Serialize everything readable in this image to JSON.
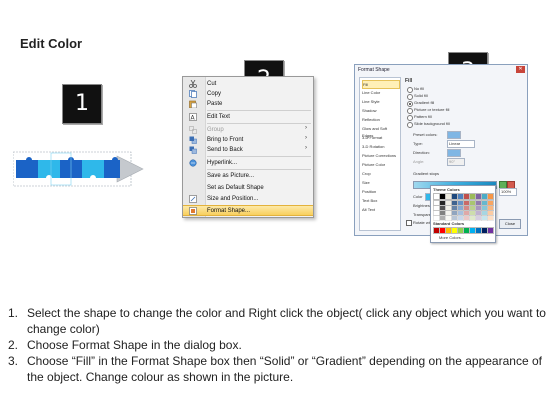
{
  "title": "Edit Color",
  "steps": [
    {
      "num": "1",
      "label": "1."
    },
    {
      "num": "2",
      "label": "2"
    },
    {
      "num": "3",
      "label": "3"
    }
  ],
  "context_menu": {
    "items": [
      {
        "label": "Cut",
        "icon": "scissors-icon",
        "disabled": false,
        "submenu": false
      },
      {
        "label": "Copy",
        "icon": "copy-icon",
        "disabled": false,
        "submenu": false
      },
      {
        "label": "Paste",
        "icon": "paste-icon",
        "disabled": false,
        "submenu": false
      },
      {
        "label": "Edit Text",
        "icon": "edit-text-icon",
        "disabled": false,
        "submenu": false
      },
      {
        "label": "Group",
        "icon": "group-icon",
        "disabled": true,
        "submenu": true
      },
      {
        "label": "Bring to Front",
        "icon": "bring-front-icon",
        "disabled": false,
        "submenu": true
      },
      {
        "label": "Send to Back",
        "icon": "send-back-icon",
        "disabled": false,
        "submenu": true
      },
      {
        "label": "Hyperlink...",
        "icon": "hyperlink-icon",
        "disabled": false,
        "submenu": false
      },
      {
        "label": "Save as Picture...",
        "icon": "",
        "disabled": false,
        "submenu": false
      },
      {
        "label": "Set as Default Shape",
        "icon": "",
        "disabled": false,
        "submenu": false
      },
      {
        "label": "Size and Position...",
        "icon": "size-position-icon",
        "disabled": false,
        "submenu": false
      },
      {
        "label": "Format Shape...",
        "icon": "format-shape-icon",
        "disabled": false,
        "submenu": false,
        "highlighted": true
      }
    ]
  },
  "format_dialog": {
    "title": "Format Shape",
    "close_glyph": "✕",
    "categories": [
      "Fill",
      "Line Color",
      "Line Style",
      "Shadow",
      "Reflection",
      "Glow and Soft Edges",
      "3-D Format",
      "3-D Rotation",
      "Picture Corrections",
      "Picture Color",
      "Crop",
      "Size",
      "Position",
      "Text Box",
      "Alt Text"
    ],
    "selected_category": "Fill",
    "pane_heading": "Fill",
    "fill_options": [
      {
        "label": "No fill",
        "selected": false
      },
      {
        "label": "Solid fill",
        "selected": false
      },
      {
        "label": "Gradient fill",
        "selected": true
      },
      {
        "label": "Picture or texture fill",
        "selected": false
      },
      {
        "label": "Pattern fill",
        "selected": false
      },
      {
        "label": "Slide background fill",
        "selected": false
      }
    ],
    "labels": {
      "preset": "Preset colors:",
      "type": "Type:",
      "type_value": "Linear",
      "direction": "Direction:",
      "angle": "Angle:",
      "angle_value": "90°",
      "stops": "Gradient stops",
      "color": "Color",
      "position": "Position:",
      "position_value": "100%",
      "brightness": "Brightness:",
      "transparency": "Transparency:",
      "rotate": "Rotate with shape",
      "theme_colors": "Theme Colors",
      "standard_colors": "Standard Colors",
      "more_colors": "More Colors...",
      "close": "Close"
    },
    "theme_swatches": [
      "#ffffff",
      "#000000",
      "#eeece1",
      "#1f497d",
      "#4f81bd",
      "#c0504d",
      "#9bbb59",
      "#8064a2",
      "#4bacc6",
      "#f79646"
    ],
    "standard_swatches": [
      "#c00000",
      "#ff0000",
      "#ffc000",
      "#ffff00",
      "#92d050",
      "#00b050",
      "#00b0f0",
      "#0070c0",
      "#002060",
      "#7030a0"
    ]
  },
  "instructions": [
    {
      "num": "1.",
      "text": "Select the shape to change the color and Right click the object( click any object which you want to change color)"
    },
    {
      "num": "2.",
      "text": "Choose Format Shape in the dialog box."
    },
    {
      "num": "3.",
      "text": "Choose “Fill” in the Format Shape box then “Solid” or “Gradient” depending on the appearance of the object. Change colour as shown in the picture."
    }
  ],
  "colors": {
    "puzzle_dark": "#1b63c6",
    "puzzle_light": "#2fb8ea",
    "arrow": "#bfc3c8",
    "badge": "#111111",
    "highlight": "#f8cf5e"
  }
}
